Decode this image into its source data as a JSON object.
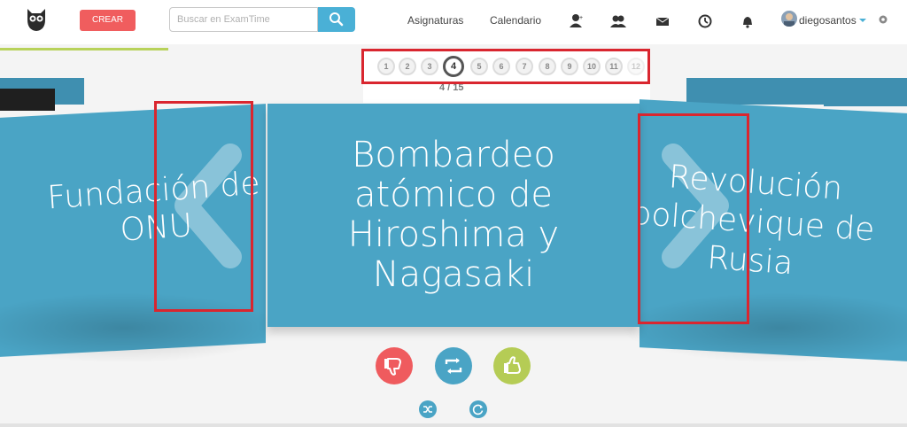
{
  "header": {
    "crear_label": "CREAR",
    "search_placeholder": "Buscar en ExamTime",
    "nav": [
      "Asignaturas",
      "Calendario"
    ],
    "username": "diegosantos",
    "icons": [
      "owl-logo-icon",
      "search-icon",
      "user-icon",
      "group-icon",
      "mail-icon",
      "history-icon",
      "bell-icon",
      "gear-icon"
    ]
  },
  "pager": {
    "pages": [
      "1",
      "2",
      "3",
      "4",
      "5",
      "6",
      "7",
      "8",
      "9",
      "10",
      "11",
      "12"
    ],
    "active_page": "4",
    "counter": "4 / 15"
  },
  "cards": {
    "left": "Fundación de\nONU",
    "center": "Bombardeo\natómico de\nHiroshima y\nNagasaki",
    "right": "Revolución\nbolchevique de\nRusia"
  },
  "controls": {
    "buttons": [
      "thumbs-down-icon",
      "flip-icon",
      "thumbs-up-icon"
    ],
    "small": [
      "shuffle-icon",
      "restart-icon"
    ]
  },
  "colors": {
    "card": "#4aa4c5",
    "accent_blue": "#4ab0d6",
    "crear_red": "#f05d5e",
    "highlight_red": "#d9262f",
    "thumb_up_green": "#b5cc55"
  }
}
